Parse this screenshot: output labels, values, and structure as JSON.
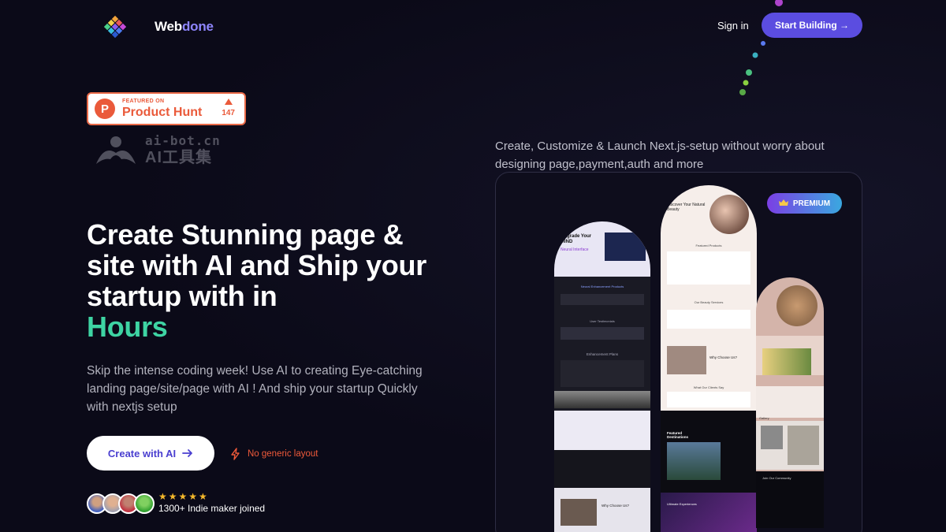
{
  "header": {
    "brand_part1": "Web",
    "brand_part2": "done",
    "signin_label": "Sign in",
    "start_label": "Start Building →"
  },
  "product_hunt": {
    "featured": "FEATURED ON",
    "name": "Product Hunt",
    "votes": "147"
  },
  "watermark": {
    "line1": "ai-bot.cn",
    "line2": "AI工具集"
  },
  "hero": {
    "title_part1": "Create Stunning page & site with AI and Ship your startup with in",
    "title_highlight": "Hours",
    "subtitle": "Skip the intense coding week! Use AI to creating Eye-catching landing page/site/page with AI ! And ship your startup Quickly with nextjs setup",
    "cta_label": "Create with AI",
    "cta_icon": "arrow-right-icon",
    "badge_icon": "lightning-icon",
    "badge_text": "No generic layout",
    "stars": "★★★★★",
    "joined_text": "1300+ Indie maker joined"
  },
  "right": {
    "description": "Create, Customize & Launch Next.js-setup without worry about designing page,payment,auth and more",
    "premium_label": "PREMIUM",
    "premium_icon": "crown-icon"
  },
  "previews": {
    "card1": {
      "headline": "Upgrade Your MIND",
      "sub": "Neural Interface",
      "section1": "Neural Enhancement Products",
      "section2": "User Testimonials",
      "section3": "Enhancement Plans",
      "section4": "Why Choose Us?"
    },
    "card2": {
      "headline": "Discover Your Natural Beauty",
      "section1": "Featured Products",
      "section2": "Our Beauty Services",
      "section3": "Why Choose Us?",
      "section4": "What Our Clients Say",
      "section5": "Featured Destinations",
      "section6": "Ultimate Experiences"
    },
    "card3": {
      "section1": "Gallery",
      "section2": "Join Our Community"
    }
  },
  "colors": {
    "accent": "#5b4de0",
    "highlight": "#3ed4a3",
    "product_hunt": "#ea5a3a"
  }
}
